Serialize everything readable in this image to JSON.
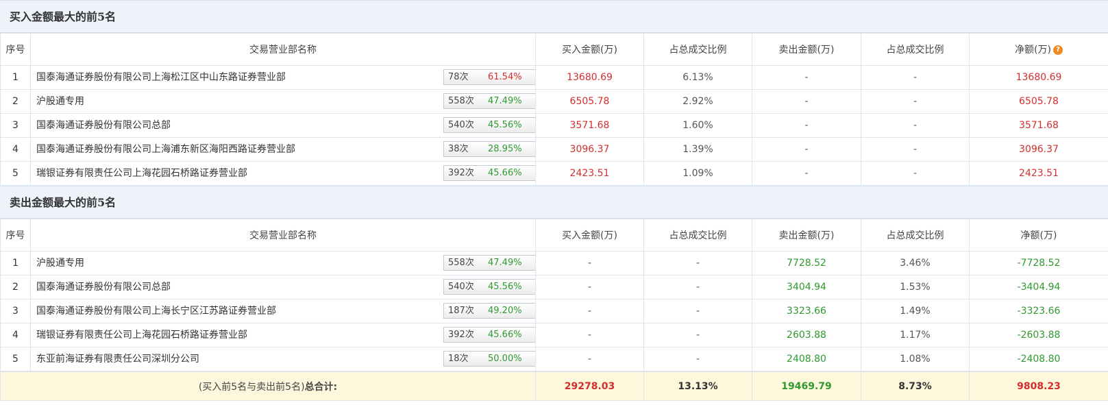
{
  "buy_section": {
    "title": "买入金额最大的前5名",
    "headers": [
      "序号",
      "交易营业部名称",
      "买入金额(万)",
      "占总成交比例",
      "卖出金额(万)",
      "占总成交比例",
      "净额(万)"
    ],
    "rows": [
      {
        "idx": "1",
        "name": "国泰海通证券股份有限公司上海松江区中山东路证券营业部",
        "times": "78次",
        "pct": "61.54%",
        "pct_color": "red",
        "icon": "question-icon",
        "buy": "13680.69",
        "buy_ratio": "6.13%",
        "sell": "-",
        "sell_ratio": "-",
        "net": "13680.69",
        "net_color": "red"
      },
      {
        "idx": "2",
        "name": "沪股通专用",
        "times": "558次",
        "pct": "47.49%",
        "pct_color": "green",
        "icon": "play-icon",
        "buy": "6505.78",
        "buy_ratio": "2.92%",
        "sell": "-",
        "sell_ratio": "-",
        "net": "6505.78",
        "net_color": "red"
      },
      {
        "idx": "3",
        "name": "国泰海通证券股份有限公司总部",
        "times": "540次",
        "pct": "45.56%",
        "pct_color": "green",
        "icon": "play-icon",
        "buy": "3571.68",
        "buy_ratio": "1.60%",
        "sell": "-",
        "sell_ratio": "-",
        "net": "3571.68",
        "net_color": "red"
      },
      {
        "idx": "4",
        "name": "国泰海通证券股份有限公司上海浦东新区海阳西路证券营业部",
        "times": "38次",
        "pct": "28.95%",
        "pct_color": "green",
        "icon": "play-icon",
        "buy": "3096.37",
        "buy_ratio": "1.39%",
        "sell": "-",
        "sell_ratio": "-",
        "net": "3096.37",
        "net_color": "red"
      },
      {
        "idx": "5",
        "name": "瑞银证券有限责任公司上海花园石桥路证券营业部",
        "times": "392次",
        "pct": "45.66%",
        "pct_color": "green",
        "icon": "play-icon",
        "buy": "2423.51",
        "buy_ratio": "1.09%",
        "sell": "-",
        "sell_ratio": "-",
        "net": "2423.51",
        "net_color": "red"
      }
    ]
  },
  "sell_section": {
    "title": "卖出金额最大的前5名",
    "headers": [
      "序号",
      "交易营业部名称",
      "买入金额(万)",
      "占总成交比例",
      "卖出金额(万)",
      "占总成交比例",
      "净额(万)"
    ],
    "rows": [
      {
        "idx": "1",
        "name": "沪股通专用",
        "times": "558次",
        "pct": "47.49%",
        "pct_color": "green",
        "icon": "question-icon",
        "buy": "-",
        "buy_ratio": "-",
        "sell": "7728.52",
        "sell_ratio": "3.46%",
        "net": "-7728.52",
        "net_color": "green"
      },
      {
        "idx": "2",
        "name": "国泰海通证券股份有限公司总部",
        "times": "540次",
        "pct": "45.56%",
        "pct_color": "green",
        "icon": "play-icon",
        "buy": "-",
        "buy_ratio": "-",
        "sell": "3404.94",
        "sell_ratio": "1.53%",
        "net": "-3404.94",
        "net_color": "green"
      },
      {
        "idx": "3",
        "name": "国泰海通证券股份有限公司上海长宁区江苏路证券营业部",
        "times": "187次",
        "pct": "49.20%",
        "pct_color": "green",
        "icon": "play-icon",
        "buy": "-",
        "buy_ratio": "-",
        "sell": "3323.66",
        "sell_ratio": "1.49%",
        "net": "-3323.66",
        "net_color": "green"
      },
      {
        "idx": "4",
        "name": "瑞银证券有限责任公司上海花园石桥路证券营业部",
        "times": "392次",
        "pct": "45.66%",
        "pct_color": "green",
        "icon": "play-icon",
        "buy": "-",
        "buy_ratio": "-",
        "sell": "2603.88",
        "sell_ratio": "1.17%",
        "net": "-2603.88",
        "net_color": "green"
      },
      {
        "idx": "5",
        "name": "东亚前海证券有限责任公司深圳分公司",
        "times": "18次",
        "pct": "50.00%",
        "pct_color": "green",
        "icon": "play-icon",
        "buy": "-",
        "buy_ratio": "-",
        "sell": "2408.80",
        "sell_ratio": "1.08%",
        "net": "-2408.80",
        "net_color": "green"
      }
    ]
  },
  "total": {
    "label_prefix": "(买入前5名与卖出前5名)",
    "label_bold": "总合计:",
    "buy": "29278.03",
    "buy_ratio": "13.13%",
    "sell": "19469.79",
    "sell_ratio": "8.73%",
    "net": "9808.23"
  },
  "colors": {
    "red": "#d32e2e",
    "green": "#2e9a2e",
    "header_bg": "#eef3fa",
    "total_bg": "#fdf7dc"
  },
  "icons": {
    "question": "?",
    "play": "play-icon"
  }
}
